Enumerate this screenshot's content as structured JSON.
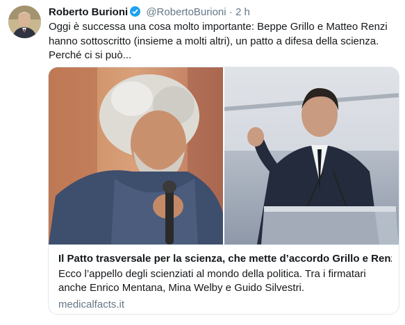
{
  "tweet": {
    "author_name": "Roberto Burioni",
    "handle": "@RobertoBurioni",
    "separator": "·",
    "time": "2 h",
    "text": "Oggi è successa una cosa molto importante: Beppe Grillo e Matteo Renzi hanno sottoscritto (insieme a molti altri), un patto a difesa della scienza. Perché ci si può..."
  },
  "card": {
    "title": "Il Patto trasversale per la scienza, che mette d’accordo Grillo e Renzi...",
    "description": "Ecco l’appello degli scienziati al mondo della politica. Tra i firmatari anche Enrico Mentana, Mina Welby e Guido Silvestri.",
    "domain": "medicalfacts.it"
  },
  "colors": {
    "verified": "#1da1f2",
    "secondary_text": "#657786",
    "border": "#e1e8ed"
  },
  "icons": {
    "verified": "verified-badge-icon"
  }
}
